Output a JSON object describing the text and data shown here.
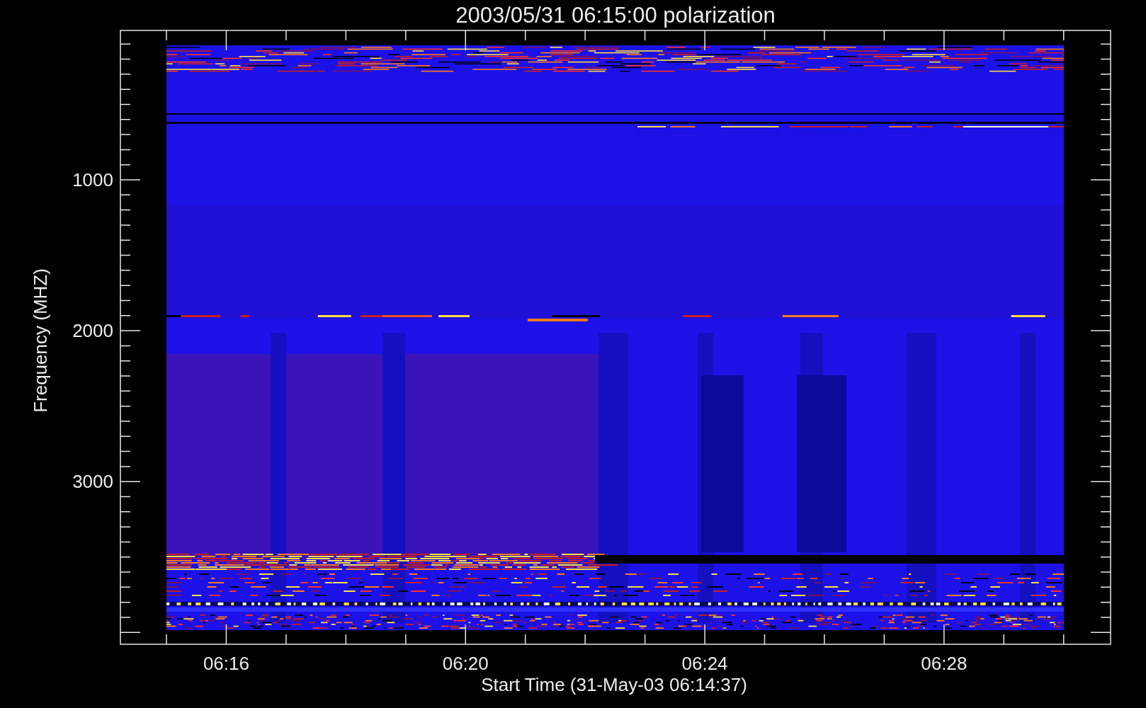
{
  "plot": {
    "title": "2003/05/31 06:15:00 polarization",
    "ylabel": "Frequency (MHZ)",
    "xlabel": "Start Time (31-May-03 06:14:37)",
    "yticks": [
      "1000",
      "2000",
      "3000"
    ],
    "xticks": [
      "06:16",
      "06:20",
      "06:24",
      "06:28"
    ]
  }
}
